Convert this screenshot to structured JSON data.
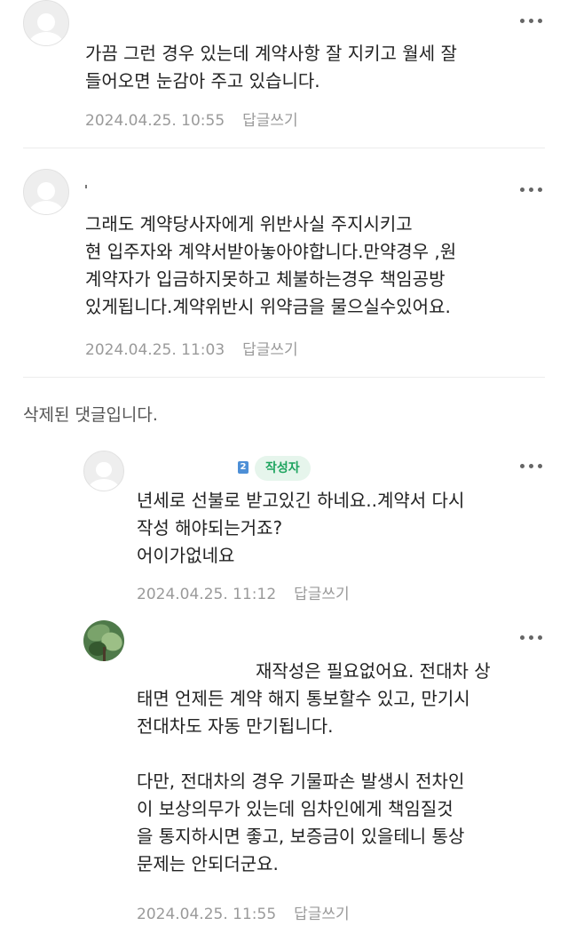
{
  "comments": [
    {
      "lines": [
        "가끔 그런 경우 있는데 계약사항 잘 지키고 월세 잘",
        "들어오면 눈감아 주고 있습니다."
      ],
      "date": "2024.04.25. 10:55",
      "reply_label": "답글쓰기"
    },
    {
      "lines": [
        "그래도 계약당사자에게 위반사실 주지시키고",
        "현 입주자와 계약서받아놓아야합니다.만약경우 ,원",
        "계약자가 입금하지못하고 체불하는경우 책임공방",
        "있게됩니다.계약위반시 위약금을 물으실수있어요."
      ],
      "date": "2024.04.25. 11:03",
      "reply_label": "답글쓰기"
    }
  ],
  "deleted_notice": "삭제된 댓글입니다.",
  "replies": [
    {
      "badge": "작성자",
      "badge_mark": "2",
      "lines": [
        "년세로 선불로 받고있긴 하네요..계약서 다시",
        "작성 해야되는거죠?",
        "어이가없네요"
      ],
      "date": "2024.04.25. 11:12",
      "reply_label": "답글쓰기"
    },
    {
      "lines": [
        "재작성은 필요없어요. 전대차 상",
        "태면 언제든 계약 해지 통보할수 있고, 만기시",
        "전대차도 자동 만기됩니다.",
        "",
        "다만, 전대차의 경우 기물파손 발생시 전차인",
        "이 보상의무가 있는데 임차인에게 책임질것",
        "을 통지하시면 좋고, 보증금이 있을테니 통상",
        "문제는 안되더군요."
      ],
      "date": "2024.04.25. 11:55",
      "reply_label": "답글쓰기"
    }
  ],
  "colors": {
    "badge_bg": "#e6f5ec",
    "badge_text": "#1ea45f",
    "meta": "#9a9a9a",
    "divider": "#ececec"
  },
  "icons": {
    "more": "more-vertical-dots-icon",
    "avatar": "default-profile-icon"
  }
}
